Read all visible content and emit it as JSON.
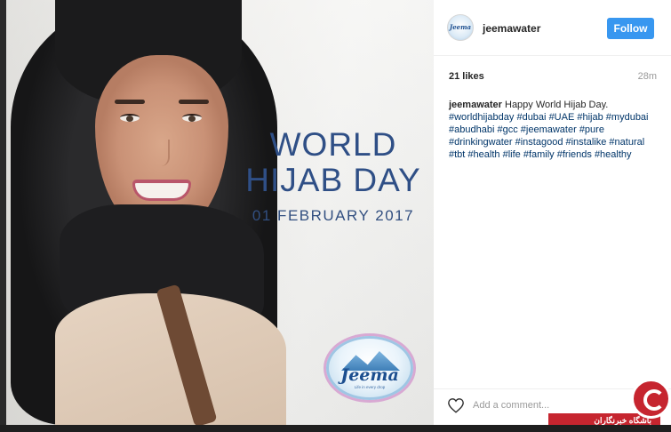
{
  "post": {
    "image": {
      "headline_line1": "WORLD",
      "headline_line2": "HIJAB DAY",
      "date": "01 FEBRUARY 2017",
      "logo_text": "Jeema",
      "logo_tagline": "Life in every drop"
    },
    "header": {
      "username": "jeemawater",
      "avatar_text": "Jeema",
      "follow_label": "Follow"
    },
    "likes": "21 likes",
    "time": "28m",
    "caption": {
      "username": "jeemawater",
      "text": "Happy World Hijab Day.",
      "hashtags": [
        "#worldhijabday",
        "#dubai",
        "#UAE",
        "#hijab",
        "#mydubai",
        "#abudhabi",
        "#gcc",
        "#jeemawater",
        "#pure",
        "#drinkingwater",
        "#instagood",
        "#instalike",
        "#natural",
        "#tbt",
        "#health",
        "#life",
        "#family",
        "#friends",
        "#healthy"
      ]
    },
    "comment_placeholder": "Add a comment...",
    "icons": {
      "like": "heart-icon"
    }
  },
  "watermark": {
    "text": "باشگاه خبرنگاران"
  },
  "colors": {
    "follow_button": "#3897f0",
    "hashtag": "#003569",
    "headline": "#2f4f86",
    "watermark": "#c6252f"
  }
}
